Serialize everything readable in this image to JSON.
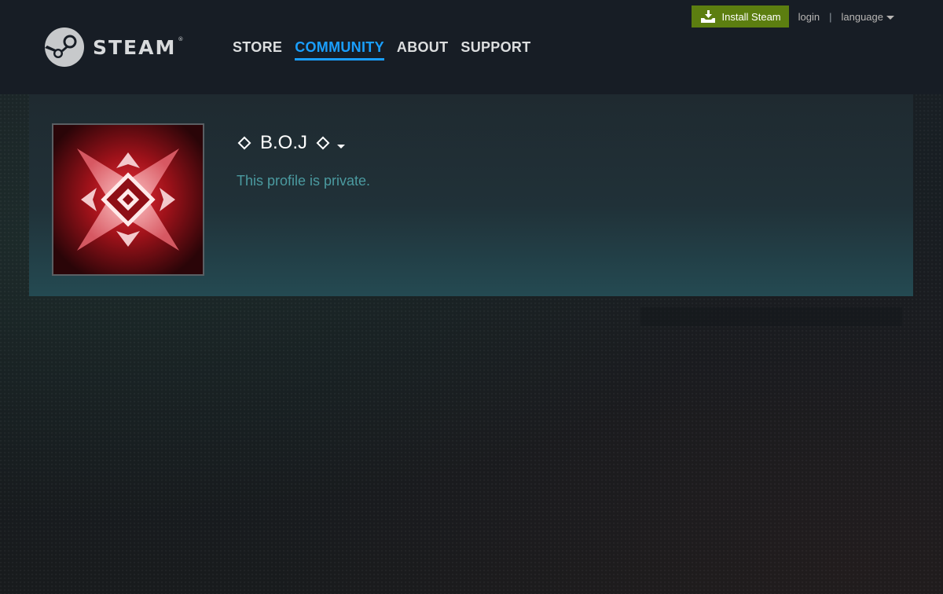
{
  "header": {
    "logo_text": "STEAM",
    "logo_reg": "®",
    "nav": [
      {
        "label": "STORE"
      },
      {
        "label": "COMMUNITY",
        "active": true
      },
      {
        "label": "ABOUT"
      },
      {
        "label": "SUPPORT"
      }
    ],
    "install_label": "Install Steam",
    "login_label": "login",
    "separator": "|",
    "language_label": "language"
  },
  "profile": {
    "persona_name": "B.O.J",
    "status_text": "This profile is private."
  },
  "colors": {
    "install_button": "#5c7e10",
    "nav_active": "#1a9fff",
    "private_text": "#4b9aa0",
    "header_bg": "#171d25"
  },
  "icons": [
    "steam-logo-icon",
    "install-download-icon",
    "chevron-down-icon",
    "diamond-icon"
  ]
}
